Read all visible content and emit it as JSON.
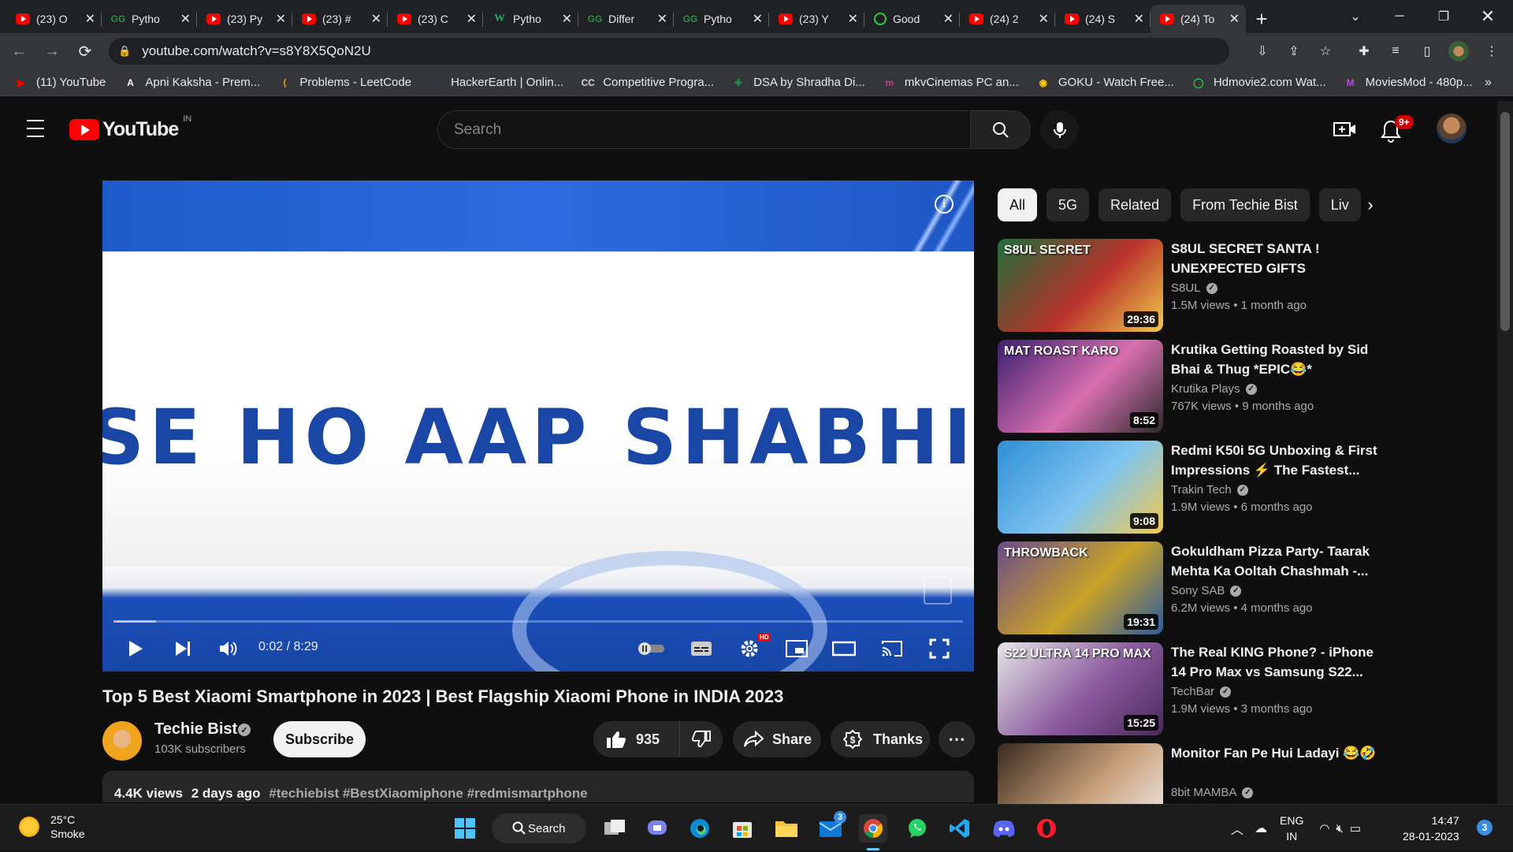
{
  "browser": {
    "tabs": [
      {
        "title": "(23) O",
        "favicon": "youtube-icon",
        "active": false
      },
      {
        "title": "Pytho",
        "favicon": "geeksforgeeks-icon",
        "active": false
      },
      {
        "title": "(23) Py",
        "favicon": "youtube-icon",
        "active": false
      },
      {
        "title": "(23) #",
        "favicon": "youtube-icon",
        "active": false
      },
      {
        "title": "(23) C",
        "favicon": "youtube-icon",
        "active": false
      },
      {
        "title": "Pytho",
        "favicon": "w3schools-icon",
        "active": false
      },
      {
        "title": "Differ",
        "favicon": "geeksforgeeks-icon",
        "active": false
      },
      {
        "title": "Pytho",
        "favicon": "geeksforgeeks-icon",
        "active": false
      },
      {
        "title": "(23) Y",
        "favicon": "youtube-icon",
        "active": false
      },
      {
        "title": "Good",
        "favicon": "circle-play-icon",
        "active": false
      },
      {
        "title": "(24) 2",
        "favicon": "youtube-icon",
        "active": false
      },
      {
        "title": "(24) S",
        "favicon": "youtube-icon",
        "active": false
      },
      {
        "title": "(24) To",
        "favicon": "youtube-icon",
        "active": true
      }
    ],
    "url": "youtube.com/watch?v=s8Y8X5QoN2U",
    "bookmarks": [
      {
        "label": "(11) YouTube",
        "icon": "youtube-icon",
        "color": "#ff0000"
      },
      {
        "label": "Apni Kaksha - Prem...",
        "icon": "apni-kaksha-icon",
        "color": "#ffffff"
      },
      {
        "label": "Problems - LeetCode",
        "icon": "leetcode-icon",
        "color": "#ffa116"
      },
      {
        "label": "HackerEarth | Onlin...",
        "icon": "hackerearth-icon",
        "color": "#323754"
      },
      {
        "label": "Competitive Progra...",
        "icon": "cc-icon",
        "color": "#d9d9d9"
      },
      {
        "label": "DSA by Shradha Di...",
        "icon": "plus-cross-icon",
        "color": "#1e8e3e"
      },
      {
        "label": "mkvCinemas PC an...",
        "icon": "mkv-icon",
        "color": "#c23b8a"
      },
      {
        "label": "GOKU - Watch Free...",
        "icon": "goku-icon",
        "color": "#ffcc00"
      },
      {
        "label": "Hdmovie2.com Wat...",
        "icon": "circle-play-icon",
        "color": "#2ecc40"
      },
      {
        "label": "MoviesMod - 480p...",
        "icon": "moviesmod-icon",
        "color": "#b44dd6"
      }
    ]
  },
  "youtube": {
    "logo_text": "YouTube",
    "country_code": "IN",
    "search_placeholder": "Search",
    "notification_count": "9+",
    "video": {
      "overlay_text": "SE HO AAP SHABHI LO",
      "time": "0:02 / 8:29",
      "progress_fraction": 0.004,
      "buffered_fraction": 0.05,
      "title": "Top 5 Best Xiaomi Smartphone in 2023 | Best Flagship Xiaomi Phone in INDIA 2023",
      "channel": "Techie Bist",
      "subscribers": "103K subscribers",
      "subscribe_label": "Subscribe",
      "likes": "935",
      "share_label": "Share",
      "thanks_label": "Thanks",
      "views": "4.4K views",
      "age": "2 days ago",
      "tags": "#techiebist #BestXiaomiphone #redmismartphone",
      "hd_badge": "HD"
    },
    "chips": [
      "All",
      "5G",
      "Related",
      "From Techie Bist",
      "Liv"
    ],
    "related": [
      {
        "title": "S8UL SECRET SANTA ! UNEXPECTED GIFTS",
        "channel": "S8UL",
        "verified": true,
        "views": "1.5M views",
        "age": "1 month ago",
        "duration": "29:36",
        "thumb_text": "S8UL SECRET",
        "thumb_colors": [
          "#1f6e3a",
          "#b8322b",
          "#f2c94c"
        ]
      },
      {
        "title": "Krutika Getting Roasted by Sid Bhai & Thug *EPIC😂*",
        "channel": "Krutika Plays",
        "verified": true,
        "views": "767K views",
        "age": "9 months ago",
        "duration": "8:52",
        "thumb_text": "MAT ROAST KARO",
        "thumb_colors": [
          "#3a1f6e",
          "#d86fb0",
          "#2b2b2b"
        ]
      },
      {
        "title": "Redmi K50i 5G Unboxing & First Impressions ⚡ The Fastest...",
        "channel": "Trakin Tech",
        "verified": true,
        "views": "1.9M views",
        "age": "6 months ago",
        "duration": "9:08",
        "thumb_text": "",
        "thumb_colors": [
          "#2f8fd6",
          "#7fc4f0",
          "#f2c94c"
        ]
      },
      {
        "title": "Gokuldham Pizza Party- Taarak Mehta Ka Ooltah Chashmah -...",
        "channel": "Sony SAB",
        "verified": true,
        "views": "6.2M views",
        "age": "4 months ago",
        "duration": "19:31",
        "thumb_text": "THROWBACK",
        "thumb_colors": [
          "#6a4b8c",
          "#c9a227",
          "#2d5aa0"
        ]
      },
      {
        "title": "The Real KING Phone? - iPhone 14 Pro Max vs Samsung S22...",
        "channel": "TechBar",
        "verified": true,
        "views": "1.9M views",
        "age": "3 months ago",
        "duration": "15:25",
        "thumb_text": "S22 ULTRA   14 PRO MAX",
        "thumb_colors": [
          "#e7e7e7",
          "#8a5a9e",
          "#4a2a5a"
        ]
      },
      {
        "title": "Monitor Fan Pe Hui Ladayi 😂🤣",
        "channel": "8bit MAMBA",
        "verified": true,
        "views": "",
        "age": "",
        "duration": "",
        "thumb_text": "",
        "thumb_colors": [
          "#3a2a1e",
          "#c8a07a",
          "#f1f1f1"
        ]
      }
    ]
  },
  "taskbar": {
    "weather_temp": "25°C",
    "weather_desc": "Smoke",
    "search_label": "Search",
    "mail_badge": "3",
    "lang_line1": "ENG",
    "lang_line2": "IN",
    "time": "14:47",
    "date": "28-01-2023",
    "notification_count": "3"
  }
}
